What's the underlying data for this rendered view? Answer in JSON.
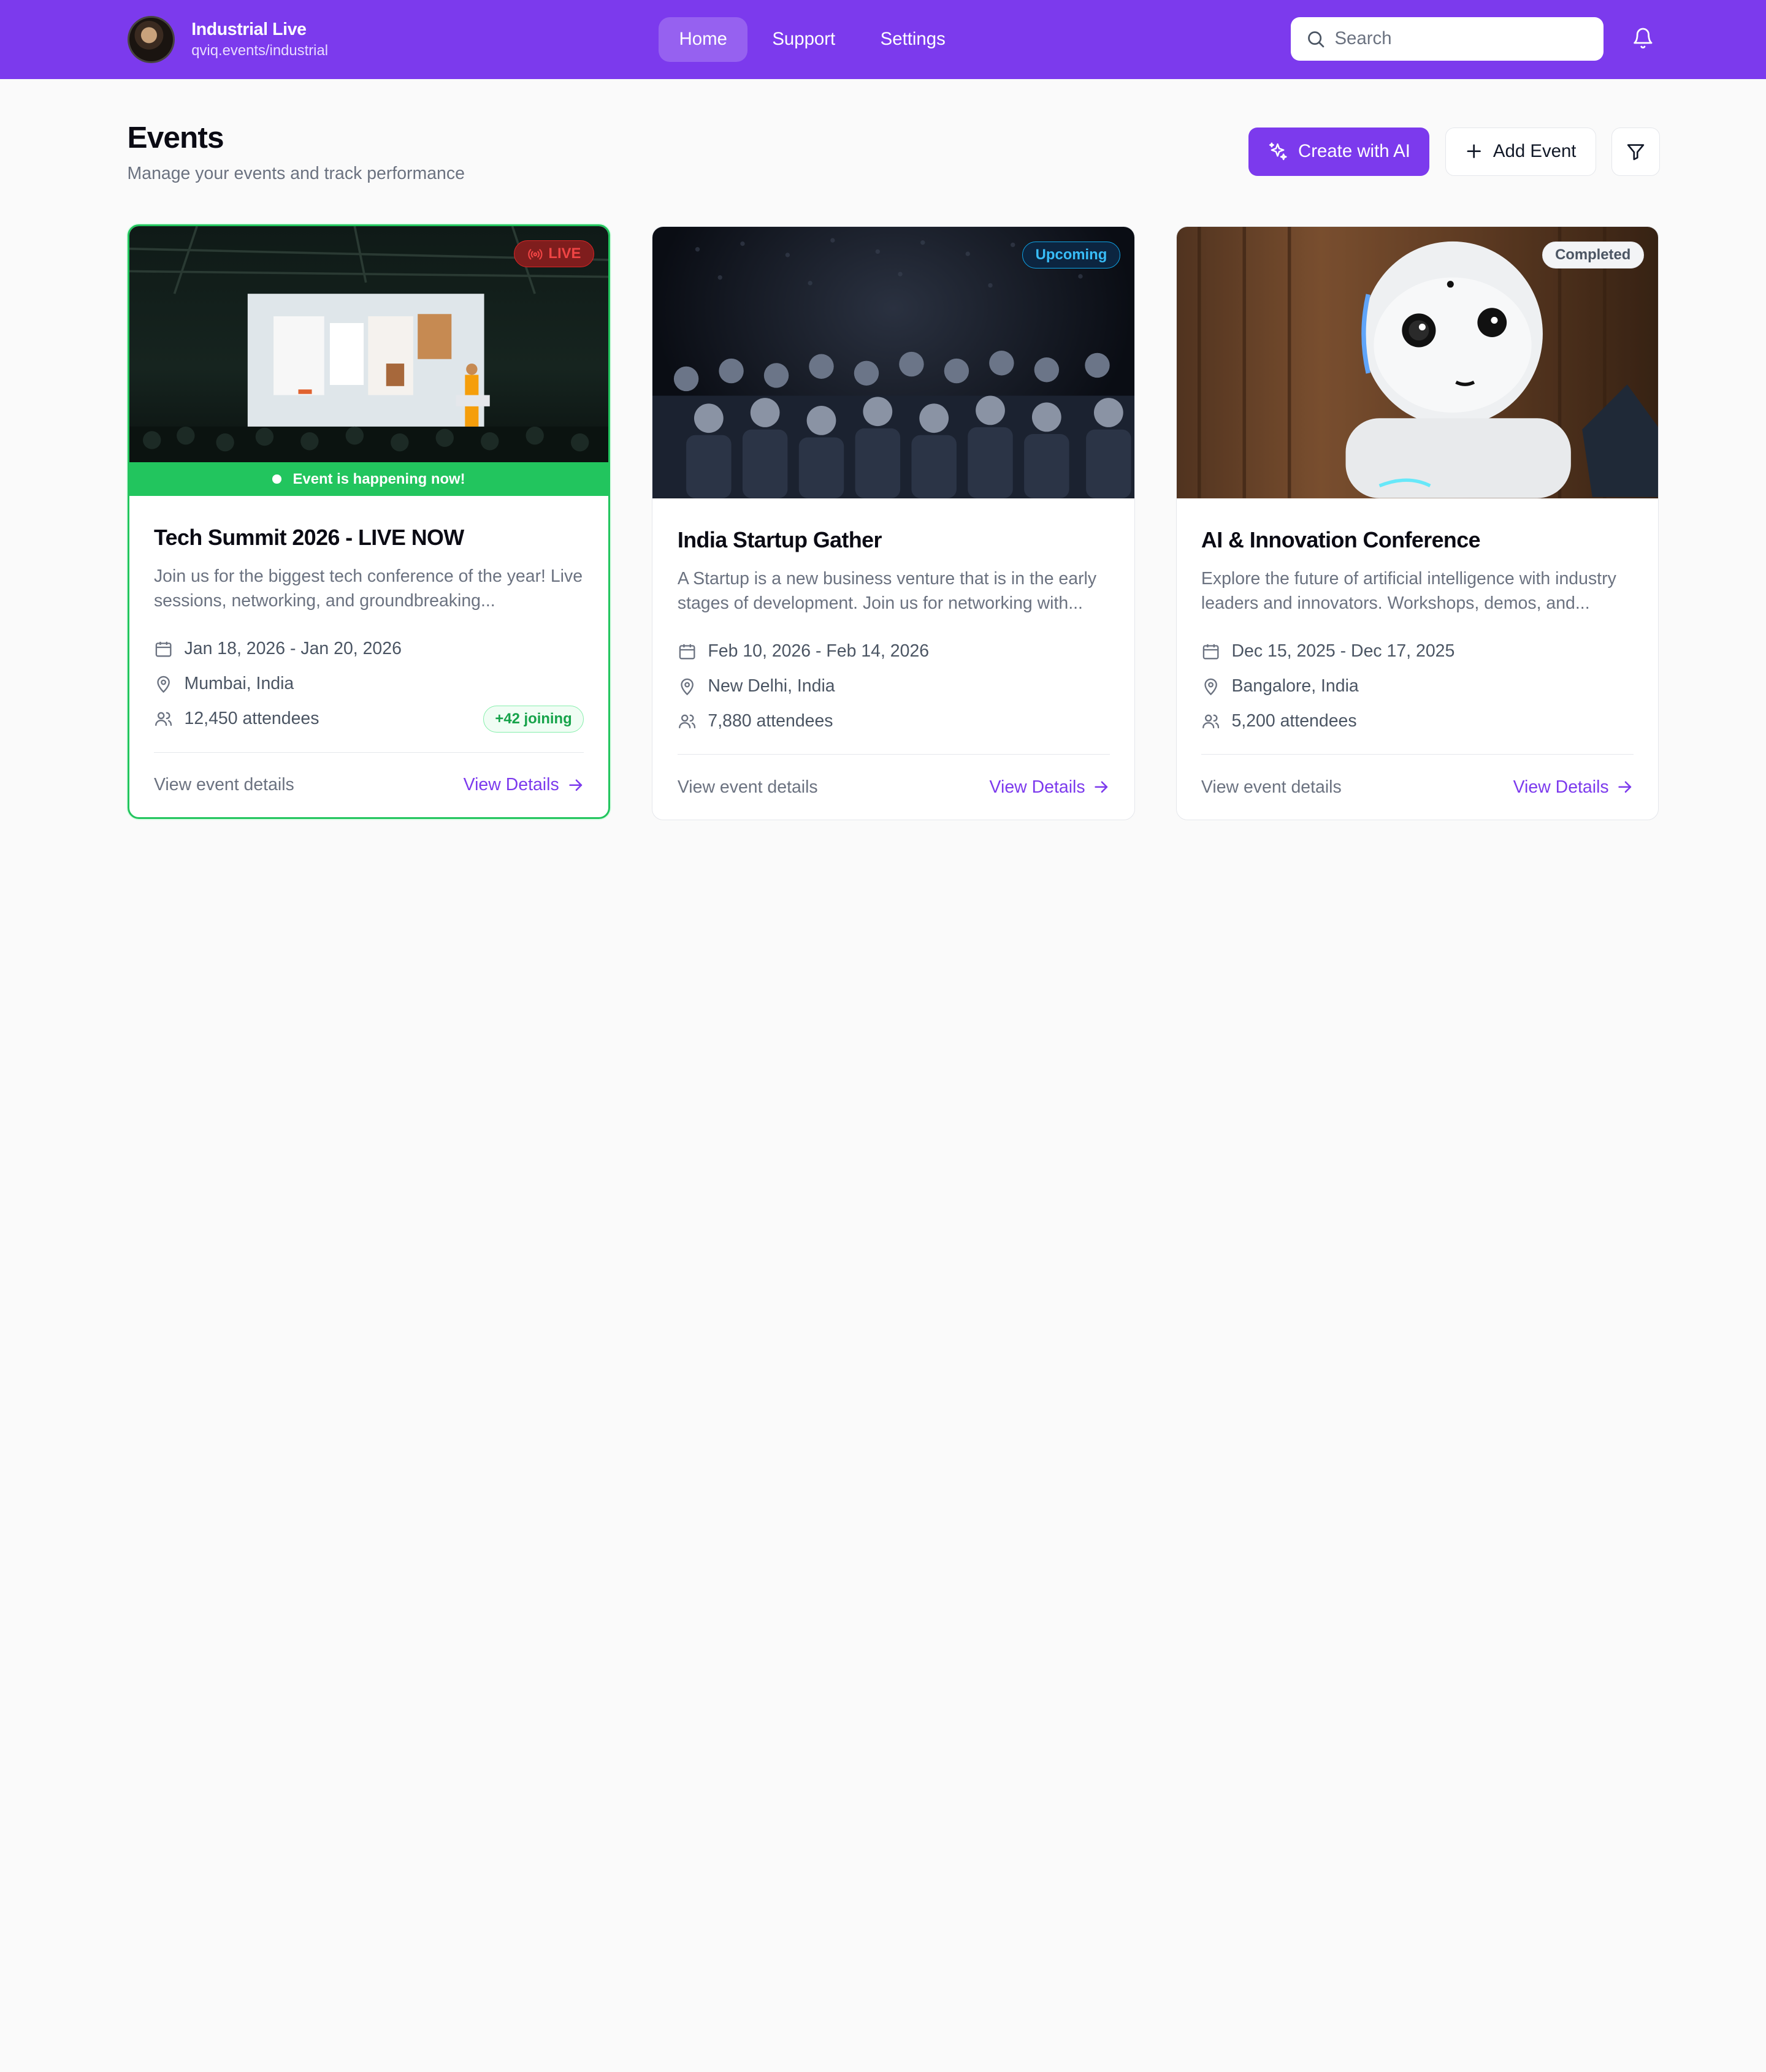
{
  "header": {
    "brand_title": "Industrial Live",
    "brand_sub": "qviq.events/industrial",
    "nav": [
      {
        "label": "Home",
        "active": true
      },
      {
        "label": "Support",
        "active": false
      },
      {
        "label": "Settings",
        "active": false
      }
    ],
    "search_placeholder": "Search",
    "accent": "#7c3aed"
  },
  "page": {
    "title": "Events",
    "subtitle": "Manage your events and track performance",
    "create_ai_label": "Create with AI",
    "add_event_label": "Add Event"
  },
  "events": [
    {
      "badge": "LIVE",
      "live_strip": "Event is happening now!",
      "title": "Tech Summit 2026 - LIVE NOW",
      "description": "Join us for the biggest tech conference of the year! Live sessions, networking, and groundbreaking...",
      "dates": "Jan 18, 2026 - Jan 20, 2026",
      "location": "Mumbai, India",
      "attendees": "12,450 attendees",
      "joining": "+42 joining",
      "foot_label": "View event details",
      "link_label": "View Details",
      "status_color": "#22c55e"
    },
    {
      "badge": "Upcoming",
      "title": "India Startup Gather",
      "description": "A Startup is a new business venture that is in the early stages of development. Join us for networking with...",
      "dates": "Feb 10, 2026 - Feb 14, 2026",
      "location": "New Delhi, India",
      "attendees": "7,880 attendees",
      "foot_label": "View event details",
      "link_label": "View Details",
      "status_color": "#0ea5e9"
    },
    {
      "badge": "Completed",
      "title": "AI & Innovation Conference",
      "description": "Explore the future of artificial intelligence with industry leaders and innovators. Workshops, demos, and...",
      "dates": "Dec 15, 2025 - Dec 17, 2025",
      "location": "Bangalore, India",
      "attendees": "5,200 attendees",
      "foot_label": "View event details",
      "link_label": "View Details",
      "status_color": "#6b7280"
    }
  ]
}
